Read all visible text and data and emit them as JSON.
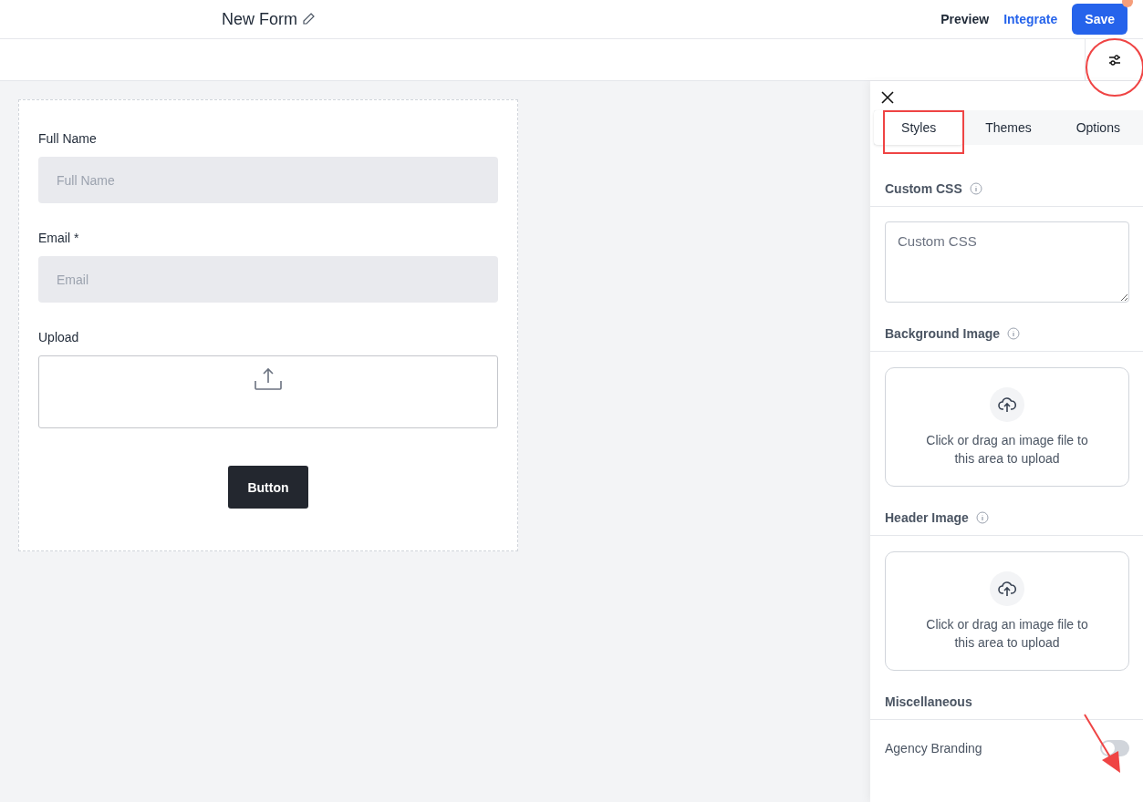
{
  "header": {
    "title": "New Form",
    "preview": "Preview",
    "integrate": "Integrate",
    "save": "Save"
  },
  "form": {
    "fields": [
      {
        "kind": "text",
        "label": "Full Name",
        "placeholder": "Full Name"
      },
      {
        "kind": "text",
        "label": "Email *",
        "placeholder": "Email"
      },
      {
        "kind": "upload",
        "label": "Upload"
      }
    ],
    "button": "Button"
  },
  "panel": {
    "tabs": [
      {
        "label": "Styles",
        "selected": true
      },
      {
        "label": "Themes",
        "selected": false
      },
      {
        "label": "Options",
        "selected": false
      }
    ],
    "sections": [
      {
        "kind": "textarea",
        "title": "Custom CSS",
        "info": true,
        "placeholder": "Custom CSS"
      },
      {
        "kind": "dropzone",
        "title": "Background Image",
        "info": true,
        "text": "Click or drag an image file to this area to upload"
      },
      {
        "kind": "dropzone",
        "title": "Header Image",
        "info": true,
        "text": "Click or drag an image file to this area to upload"
      },
      {
        "kind": "toggles",
        "title": "Miscellaneous",
        "info": false,
        "items": [
          {
            "label": "Agency Branding",
            "on": false
          }
        ]
      }
    ]
  }
}
